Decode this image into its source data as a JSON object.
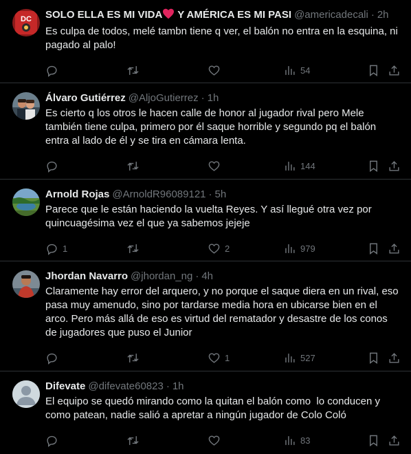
{
  "tweets": [
    {
      "name": "SOLO ELLA ES MI VIDA",
      "name_suffix": " Y AMÉRICA ES MI PASI",
      "handle": "@americadecali",
      "time": "2h",
      "text": "Es culpa de todos, melé tambn tiene q ver, el balón no entra en la esquina, ni pagado al palo!",
      "replies": "",
      "retweets": "",
      "likes": "",
      "views": "54",
      "avatar": "team-crest-avatar"
    },
    {
      "name": "Álvaro Gutiérrez",
      "handle": "@AljoGutierrez",
      "time": "1h",
      "text": "Es cierto q los otros le hacen calle de honor al jugador rival pero Mele también tiene culpa, primero por él saque horrible y segundo pq el balón entra al lado de él y se tira en cámara lenta.",
      "replies": "",
      "retweets": "",
      "likes": "",
      "views": "144",
      "avatar": "couple-photo-avatar"
    },
    {
      "name": "Arnold Rojas",
      "handle": "@ArnoldR96089121",
      "time": "5h",
      "text": "Parece que le están haciendo la vuelta Reyes. Y así llegué otra vez por quincuagésima vez el que ya sabemos jejeje",
      "replies": "1",
      "retweets": "",
      "likes": "2",
      "views": "979",
      "avatar": "landscape-avatar"
    },
    {
      "name": "Jhordan Navarro",
      "handle": "@jhordan_ng",
      "time": "4h",
      "text": "Claramente hay error del arquero, y no porque el saque diera en un rival, eso pasa muy amenudo, sino por tardarse media hora en ubicarse bien en el arco. Pero más allá de eso es virtud del rematador y desastre de los conos de jugadores que puso el Junior",
      "replies": "",
      "retweets": "",
      "likes": "1",
      "views": "527",
      "avatar": "person-photo-avatar"
    },
    {
      "name": "Difevate",
      "handle": "@difevate60823",
      "time": "1h",
      "text": "El equipo se quedó mirando como la quitan el balón como  lo conducen y como patean, nadie salió a apretar a ningún jugador de Colo Coló",
      "replies": "",
      "retweets": "",
      "likes": "",
      "views": "83",
      "avatar": "default-avatar"
    }
  ],
  "colors": {
    "background": "#000000",
    "text": "#e7e9ea",
    "muted": "#71767b",
    "divider": "#2f3336",
    "heart_emoji": "#e0245e"
  },
  "ui": {
    "dot": "·"
  }
}
